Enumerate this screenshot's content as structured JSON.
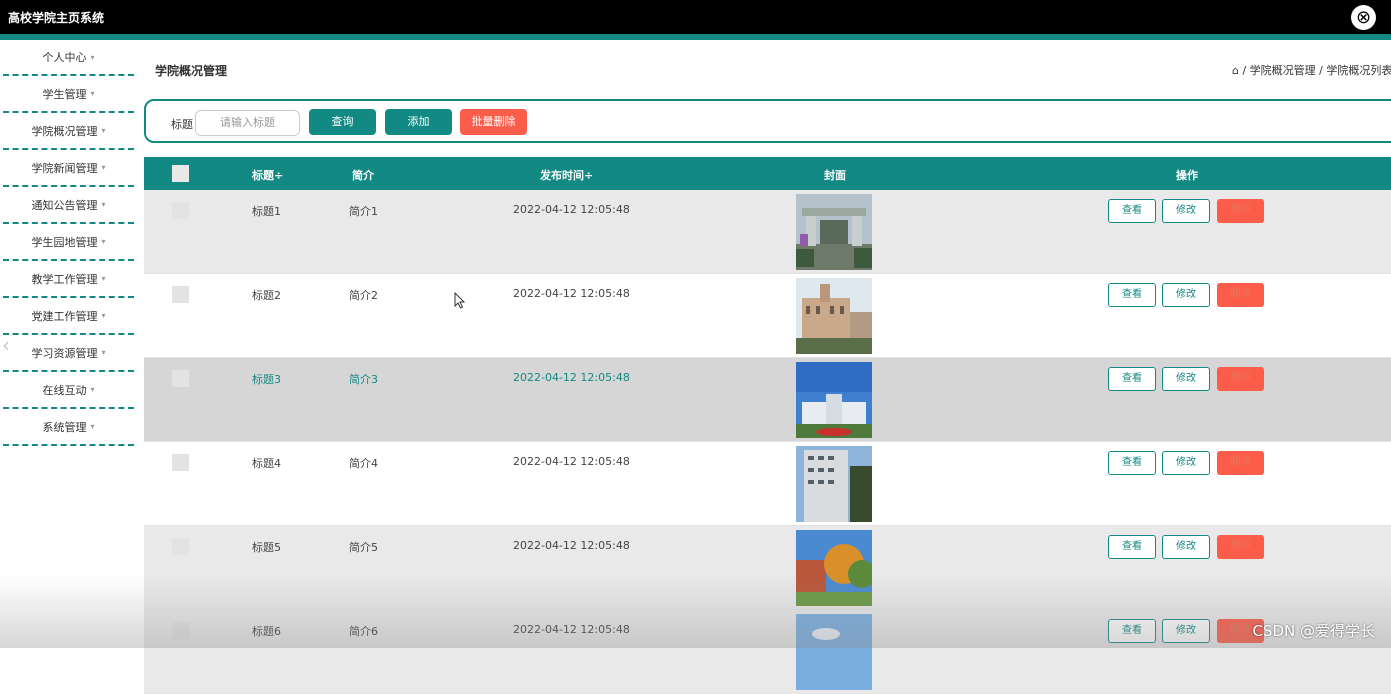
{
  "header": {
    "app_title": "高校学院主页系统",
    "close_icon": "close-circle-icon"
  },
  "sidebar": {
    "items": [
      {
        "label": "个人中心"
      },
      {
        "label": "学生管理"
      },
      {
        "label": "学院概况管理"
      },
      {
        "label": "学院新闻管理"
      },
      {
        "label": "通知公告管理"
      },
      {
        "label": "学生园地管理"
      },
      {
        "label": "教学工作管理"
      },
      {
        "label": "党建工作管理"
      },
      {
        "label": "学习资源管理"
      },
      {
        "label": "在线互动"
      },
      {
        "label": "系统管理"
      }
    ],
    "caret": "▾",
    "collapse_arrow": "‹"
  },
  "page": {
    "title": "学院概况管理",
    "breadcrumb": "⌂ / 学院概况管理 / 学院概况列表"
  },
  "search": {
    "label": "标题",
    "placeholder": "请输入标题",
    "query_label": "查询",
    "add_label": "添加",
    "batch_delete_label": "批量删除"
  },
  "table": {
    "columns": {
      "title": "标题÷",
      "intro": "简介",
      "publish_time": "发布时间÷",
      "cover": "封面",
      "actions": "操作"
    },
    "action_labels": {
      "view": "查看",
      "edit": "修改",
      "delete": "删除"
    },
    "rows": [
      {
        "title": "标题1",
        "intro": "简介1",
        "time": "2022-04-12 12:05:48",
        "cover": "campus-gate"
      },
      {
        "title": "标题2",
        "intro": "简介2",
        "time": "2022-04-12 12:05:48",
        "cover": "old-building"
      },
      {
        "title": "标题3",
        "intro": "简介3",
        "time": "2022-04-12 12:05:48",
        "cover": "modern-building"
      },
      {
        "title": "标题4",
        "intro": "简介4",
        "time": "2022-04-12 12:05:48",
        "cover": "tall-building"
      },
      {
        "title": "标题5",
        "intro": "简介5",
        "time": "2022-04-12 12:05:48",
        "cover": "autumn-trees"
      },
      {
        "title": "标题6",
        "intro": "简介6",
        "time": "2022-04-12 12:05:48",
        "cover": "sky"
      }
    ]
  },
  "colors": {
    "accent": "#138984",
    "danger": "#fc5c4a",
    "topbar": "#000000"
  },
  "watermark": "CSDN @爱得学长"
}
